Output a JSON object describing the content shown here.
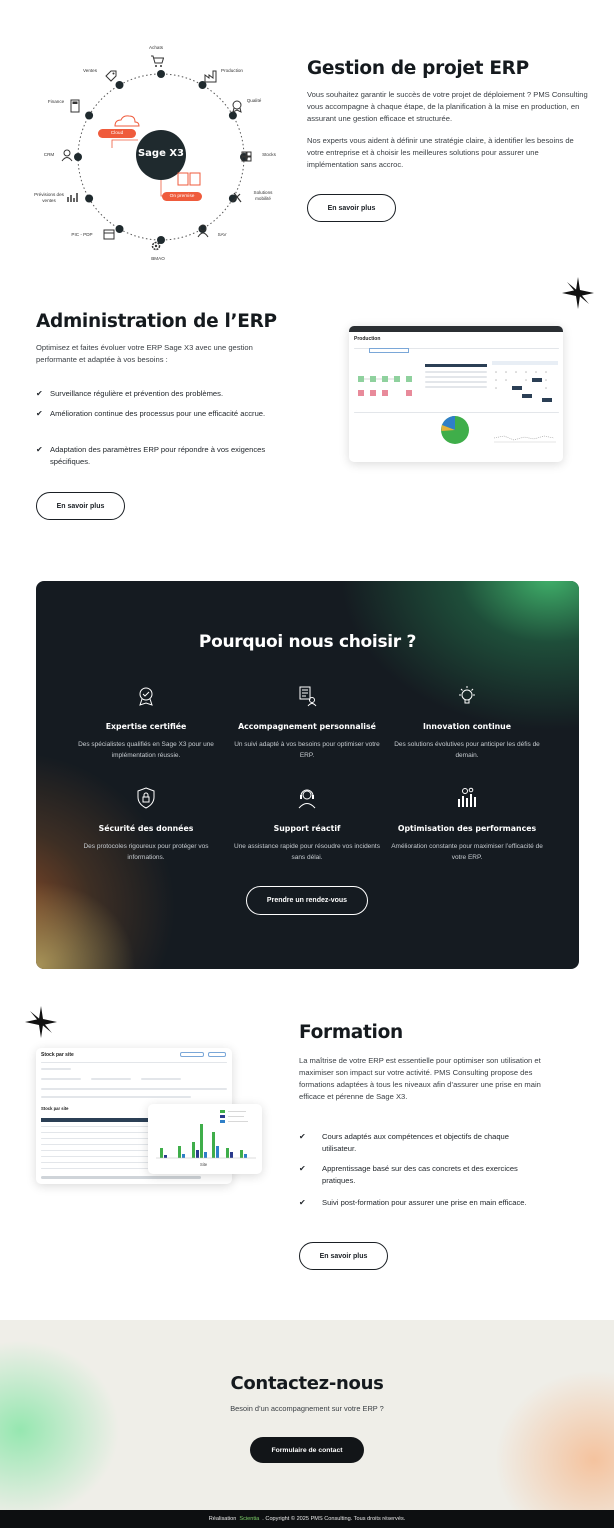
{
  "erp_diagram": {
    "center": "Sage X3",
    "cloud_tag": "Cloud",
    "premise_tag": "On premise",
    "nodes": [
      "Achats",
      "Production",
      "Qualité",
      "Stocks",
      "Solutions mobilité",
      "SAV",
      "BMAO",
      "PIC - PDP",
      "Prévisions des ventes",
      "CRM",
      "Finance",
      "Ventes"
    ],
    "accent": "#ef5b3c",
    "dark": "#1f2a2e"
  },
  "gestion": {
    "title": "Gestion de projet ERP",
    "p1": "Vous souhaitez garantir le succès de votre projet de déploiement ? PMS Consulting vous accompagne à chaque étape, de la planification à la mise en production, en assurant une gestion efficace et structurée.",
    "p2": "Nos experts vous aident à définir une stratégie claire, à identifier les besoins de votre entreprise et à choisir les meilleures solutions pour assurer une implémentation sans accroc.",
    "button": "En savoir plus"
  },
  "administration": {
    "title": "Administration de l’ERP",
    "intro": "Optimisez et faites évoluer votre ERP Sage X3 avec une gestion performante et adaptée à vos besoins :",
    "items": [
      "Surveillance régulière et prévention des problèmes.",
      "Amélioration continue des processus pour une efficacité accrue.",
      "Adaptation des paramètres ERP pour répondre à vos exigences spécifiques."
    ],
    "button": "En savoir plus",
    "mock_title": "Production"
  },
  "pourquoi": {
    "title": "Pourquoi nous choisir ?",
    "features": [
      {
        "title": "Expertise certifiée",
        "desc": "Des spécialistes qualifiés en Sage X3 pour une implémentation réussie.",
        "icon": "certified-badge-icon"
      },
      {
        "title": "Accompagnement personnalisé",
        "desc": "Un suivi adapté à vos besoins pour optimiser votre ERP.",
        "icon": "personal-support-icon"
      },
      {
        "title": "Innovation continue",
        "desc": "Des solutions évolutives pour anticiper les défis de demain.",
        "icon": "lightbulb-icon"
      },
      {
        "title": "Sécurité des données",
        "desc": "Des protocoles rigoureux pour protéger vos informations.",
        "icon": "shield-lock-icon"
      },
      {
        "title": "Support réactif",
        "desc": "Une assistance rapide pour résoudre vos incidents sans délai.",
        "icon": "headset-agent-icon"
      },
      {
        "title": "Optimisation des performances",
        "desc": "Amélioration constante pour maximiser l’efficacité de votre ERP.",
        "icon": "performance-chart-icon"
      }
    ],
    "button": "Prendre un rendez-vous"
  },
  "formation": {
    "title": "Formation",
    "intro": "La maîtrise de votre ERP est essentielle pour optimiser son utilisation et maximiser son impact sur votre activité. PMS Consulting propose des formations adaptées à tous les niveaux afin d’assurer une prise en main efficace et pérenne de Sage X3.",
    "items": [
      "Cours adaptés aux compétences et objectifs de chaque utilisateur.",
      "Apprentissage basé sur des cas concrets et des exercices pratiques.",
      "Suivi post-formation pour assurer une prise en main efficace."
    ],
    "button": "En savoir plus",
    "mock_title": "Stock par site",
    "mock_sub": "Stock par site",
    "mock_axis": "Site"
  },
  "contact": {
    "title": "Contactez-nous",
    "subtitle": "Besoin d’un accompagnement sur votre ERP ?",
    "button": "Formulaire de contact"
  },
  "footer": {
    "prefix": "Réalisation",
    "brand": "Scientia",
    "suffix": ". Copyright © 2025 PMS Consulting. Tous droits réservés."
  }
}
